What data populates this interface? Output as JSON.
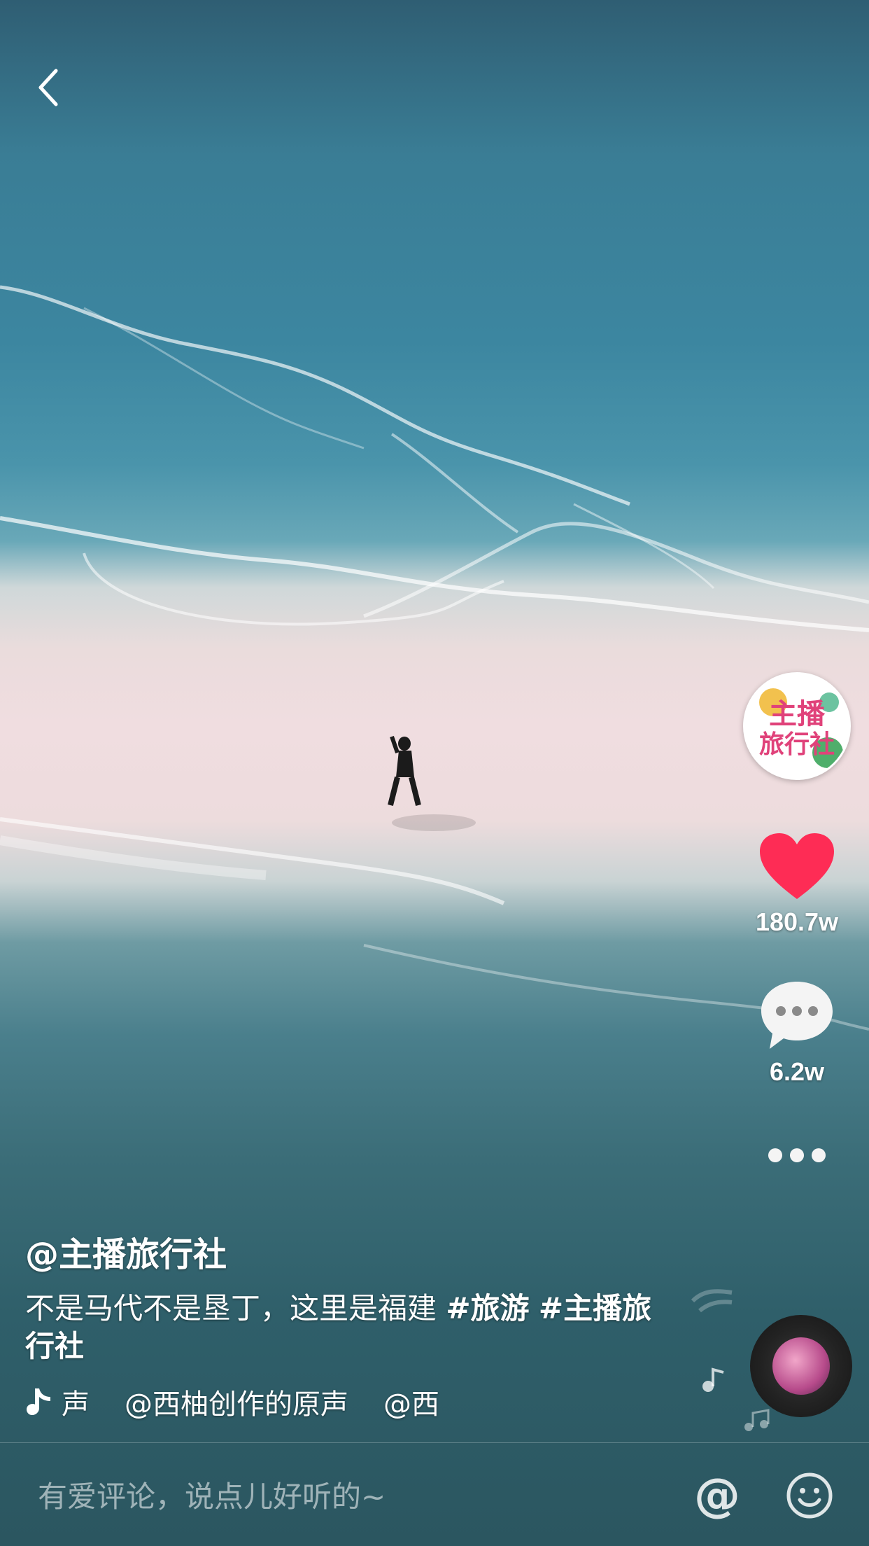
{
  "video": {
    "author_handle": "@主播旅行社",
    "description_text": "不是马代不是垦丁，这里是福建 ",
    "hashtags": [
      "#旅游",
      "#主播旅行社"
    ],
    "music_items": [
      "声",
      "@西柚创作的原声",
      "@西"
    ]
  },
  "sidebar": {
    "avatar_lettering": "主播旅行社",
    "likes_count": "180.7w",
    "comments_count": "6.2w"
  },
  "comment_bar": {
    "placeholder": "有爱评论，说点儿好听的~",
    "at_symbol": "@"
  },
  "colors": {
    "like_red": "#fe2c55",
    "water": "#3c86a0",
    "sand": "#eedcde"
  },
  "icons": [
    "back-chevron-icon",
    "heart-icon",
    "comment-bubble-icon",
    "more-dots-icon",
    "tiktok-note-icon",
    "music-note-icon",
    "at-icon",
    "emoji-icon"
  ]
}
